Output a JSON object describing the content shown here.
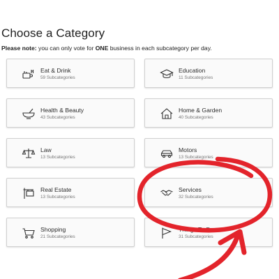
{
  "page": {
    "title": "Choose a Category",
    "note_prefix": "Please note:",
    "note_part1": " you can only vote for ",
    "note_emphasis": "ONE",
    "note_part2": " business in each subcategory per day."
  },
  "categories": [
    {
      "name": "Eat & Drink",
      "sub": "59 Subcategories",
      "icon": "food-drink-icon"
    },
    {
      "name": "Education",
      "sub": "11 Subcategories",
      "icon": "graduation-cap-icon"
    },
    {
      "name": "Health & Beauty",
      "sub": "43 Subcategories",
      "icon": "mortar-pestle-icon"
    },
    {
      "name": "Home & Garden",
      "sub": "40 Subcategories",
      "icon": "house-icon"
    },
    {
      "name": "Law",
      "sub": "13 Subcategories",
      "icon": "scales-icon"
    },
    {
      "name": "Motors",
      "sub": "13 Subcategories",
      "icon": "car-icon"
    },
    {
      "name": "Real Estate",
      "sub": "13 Subcategories",
      "icon": "sign-post-icon"
    },
    {
      "name": "Services",
      "sub": "32 Subcategories",
      "icon": "handshake-icon"
    },
    {
      "name": "Shopping",
      "sub": "21 Subcategories",
      "icon": "shopping-cart-icon"
    },
    {
      "name": "Things To Do",
      "sub": "31 Subcategories",
      "icon": "flag-icon"
    }
  ],
  "colors": {
    "annotation": "#e3242b",
    "card_border": "#d0d0d0",
    "icon_stroke": "#333333"
  }
}
